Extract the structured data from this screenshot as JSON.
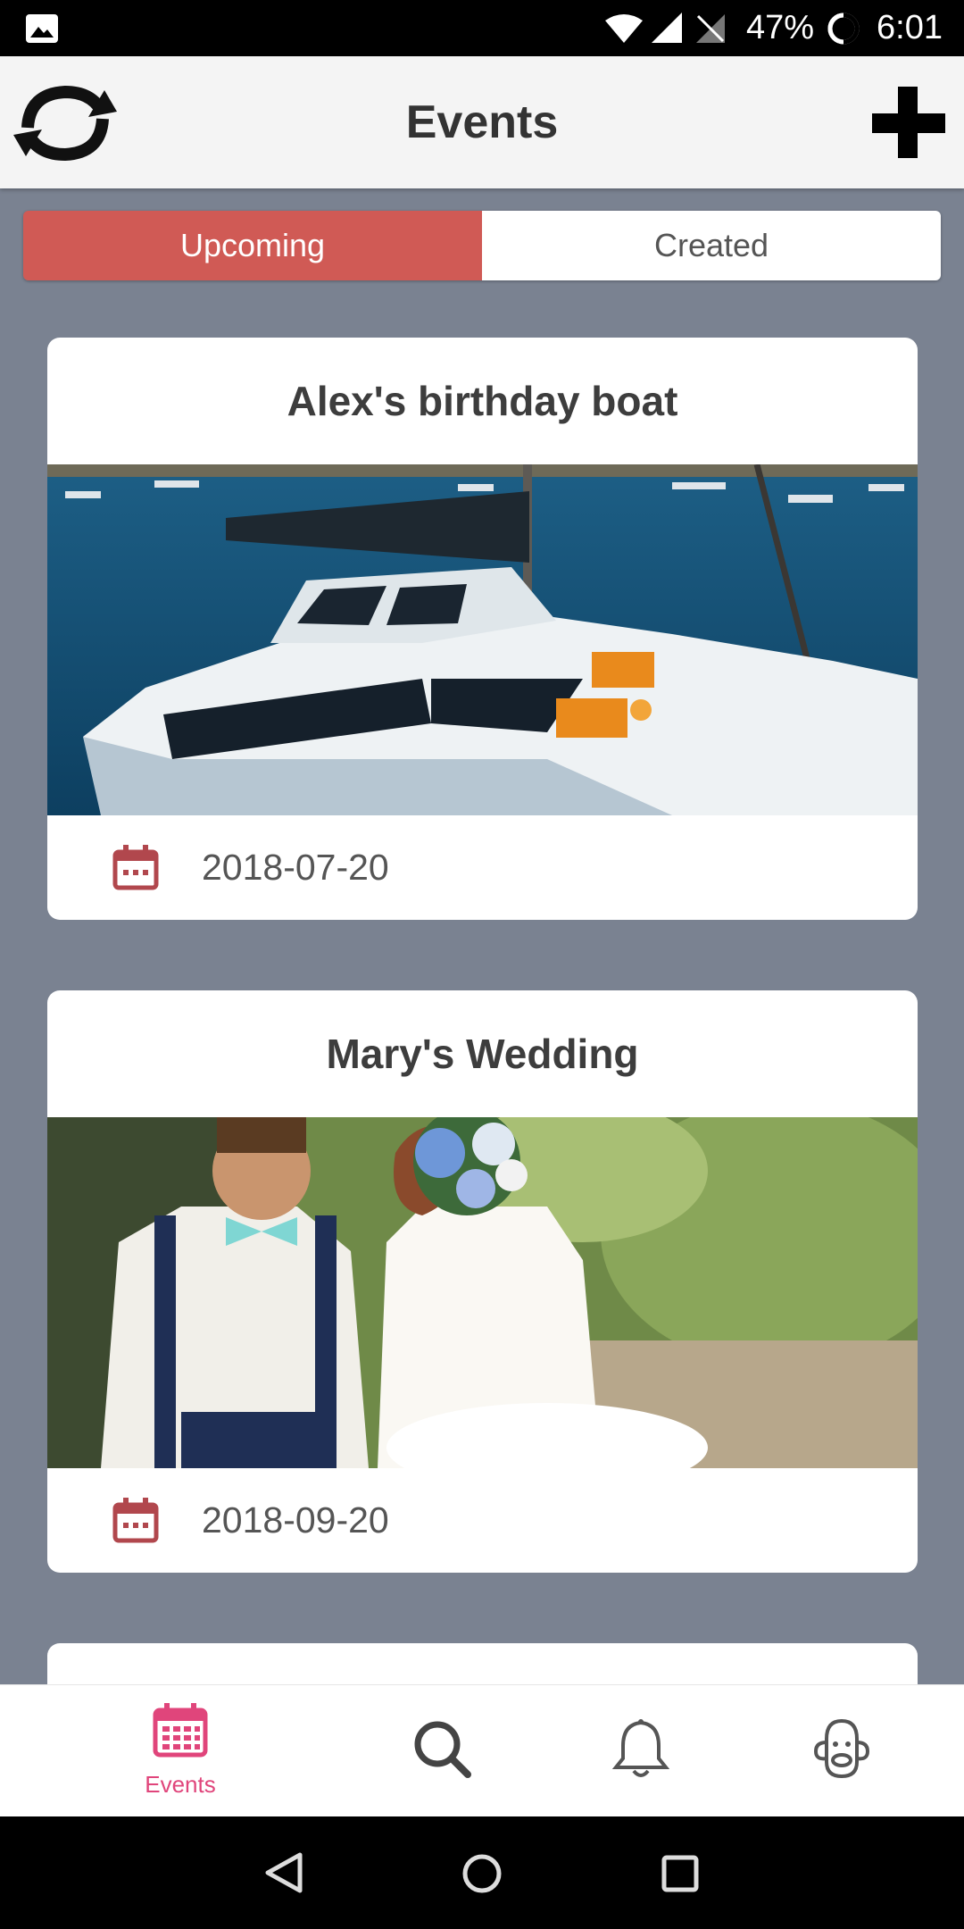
{
  "status_bar": {
    "battery": "47%",
    "time": "6:01"
  },
  "header": {
    "title": "Events"
  },
  "tabs": [
    {
      "label": "Upcoming",
      "active": true
    },
    {
      "label": "Created",
      "active": false
    }
  ],
  "events": [
    {
      "title": "Alex's birthday boat",
      "date": "2018-07-20"
    },
    {
      "title": "Mary's Wedding",
      "date": "2018-09-20"
    }
  ],
  "bottom_nav": [
    {
      "icon": "calendar-icon",
      "label": "Events",
      "active": true
    },
    {
      "icon": "search-icon",
      "label": "",
      "active": false
    },
    {
      "icon": "bell-icon",
      "label": "",
      "active": false
    },
    {
      "icon": "profile-icon",
      "label": "",
      "active": false
    }
  ],
  "colors": {
    "accent": "#d05a55",
    "nav_active": "#e0457b",
    "background": "#7a8291"
  }
}
